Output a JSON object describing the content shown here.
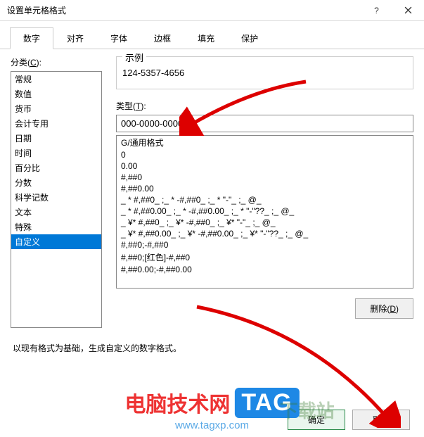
{
  "titlebar": {
    "title": "设置单元格格式"
  },
  "tabs": [
    "数字",
    "对齐",
    "字体",
    "边框",
    "填充",
    "保护"
  ],
  "category": {
    "label": "分类(C):",
    "items": [
      "常规",
      "数值",
      "货币",
      "会计专用",
      "日期",
      "时间",
      "百分比",
      "分数",
      "科学记数",
      "文本",
      "特殊",
      "自定义"
    ],
    "selected_index": 11
  },
  "sample": {
    "label": "示例",
    "value": "124-5357-4656"
  },
  "type": {
    "label": "类型(T):",
    "value": "000-0000-0000"
  },
  "formats": [
    "G/通用格式",
    "0",
    "0.00",
    "#,##0",
    "#,##0.00",
    "_ * #,##0_ ;_ * -#,##0_ ;_ * \"-\"_ ;_ @_ ",
    "_ * #,##0.00_ ;_ * -#,##0.00_ ;_ * \"-\"??_ ;_ @_ ",
    "_ ¥* #,##0_ ;_ ¥* -#,##0_ ;_ ¥* \"-\"_ ;_ @_ ",
    "_ ¥* #,##0.00_ ;_ ¥* -#,##0.00_ ;_ ¥* \"-\"??_ ;_ @_ ",
    "#,##0;-#,##0",
    "#,##0;[红色]-#,##0",
    "#,##0.00;-#,##0.00"
  ],
  "delete_label": "删除(D)",
  "hint": "以现有格式为基础，生成自定义的数字格式。",
  "footer": {
    "ok": "确定",
    "cancel": "取消"
  },
  "watermark": {
    "text": "电脑技术网",
    "tag": "TAG",
    "url": "www.tagxp.com",
    "dl": "下载站"
  }
}
